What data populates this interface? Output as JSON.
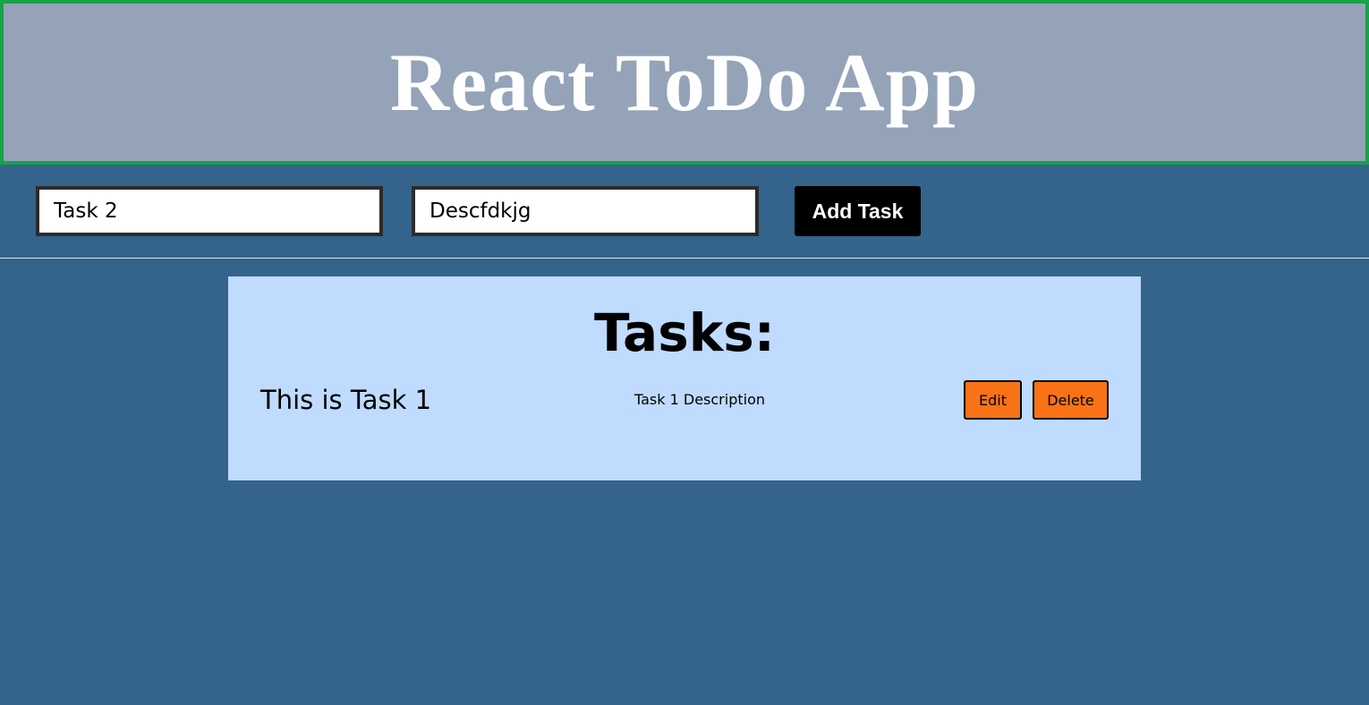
{
  "header": {
    "title": "React ToDo App"
  },
  "form": {
    "title_value": "Task 2",
    "description_value": "Descfdkjg",
    "add_button_label": "Add Task"
  },
  "tasks": {
    "heading": "Tasks:",
    "items": [
      {
        "title": "This is Task 1",
        "description": "Task 1 Description",
        "edit_label": "Edit",
        "delete_label": "Delete"
      }
    ]
  },
  "colors": {
    "page_background": "#34648b",
    "header_background": "#94a3b8",
    "header_border": "#16a34a",
    "panel_background": "#bfdbfe",
    "action_button": "#f97316",
    "add_button": "#000000"
  }
}
